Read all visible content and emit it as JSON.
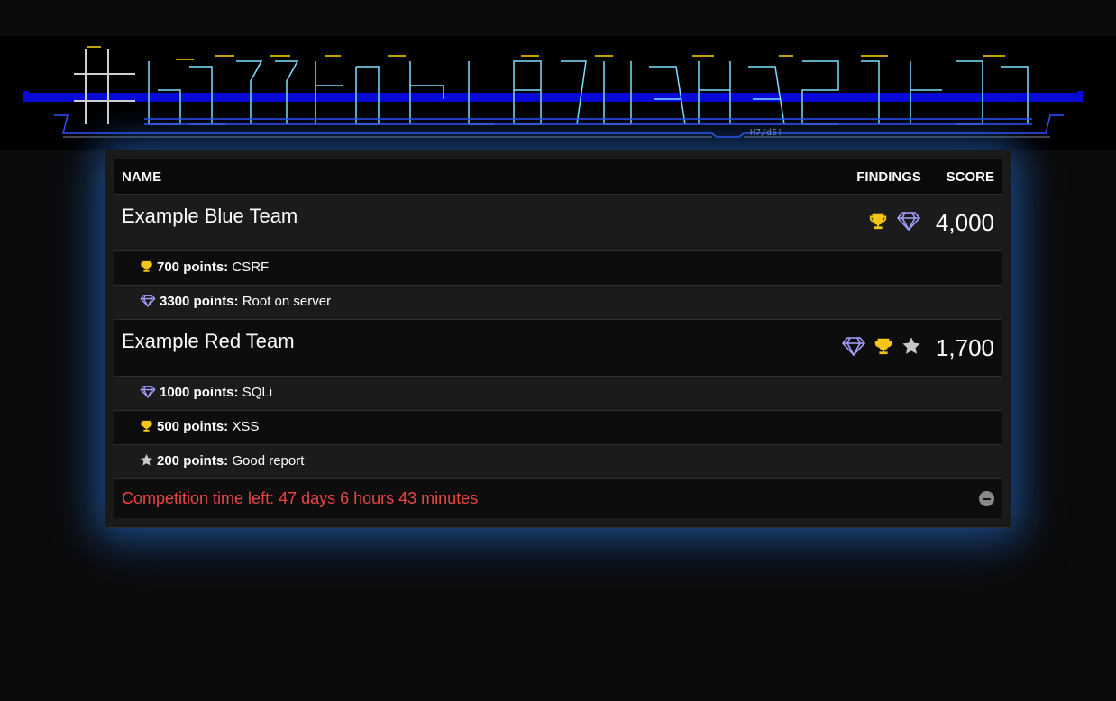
{
  "banner": {
    "logo_text": "#bittnoit-BLUeHAsk-IT",
    "credit": "H7/d5!"
  },
  "table": {
    "headers": {
      "name": "NAME",
      "findings": "FINDINGS",
      "score": "SCORE"
    },
    "teams": [
      {
        "name": "Example Blue Team",
        "score": "4,000",
        "icons": [
          "trophy-icon",
          "diamond-icon"
        ],
        "findings": [
          {
            "icon": "trophy-icon",
            "points": "700 points:",
            "title": "CSRF"
          },
          {
            "icon": "diamond-icon",
            "points": "3300 points:",
            "title": "Root on server"
          }
        ]
      },
      {
        "name": "Example Red Team",
        "score": "1,700",
        "icons": [
          "diamond-icon",
          "trophy-icon",
          "star-icon"
        ],
        "findings": [
          {
            "icon": "diamond-icon",
            "points": "1000 points:",
            "title": "SQLi"
          },
          {
            "icon": "trophy-icon",
            "points": "500 points:",
            "title": "XSS"
          },
          {
            "icon": "star-icon",
            "points": "200 points:",
            "title": "Good report"
          }
        ]
      }
    ],
    "footer": {
      "time_left": "Competition time left: 47 days 6 hours 43 minutes"
    }
  },
  "colors": {
    "trophy": "#f5c518",
    "diamond": "#a3a0ff",
    "star": "#c8c8c8",
    "time_left": "#e94646",
    "banner_bar": "#0a0ad8"
  }
}
